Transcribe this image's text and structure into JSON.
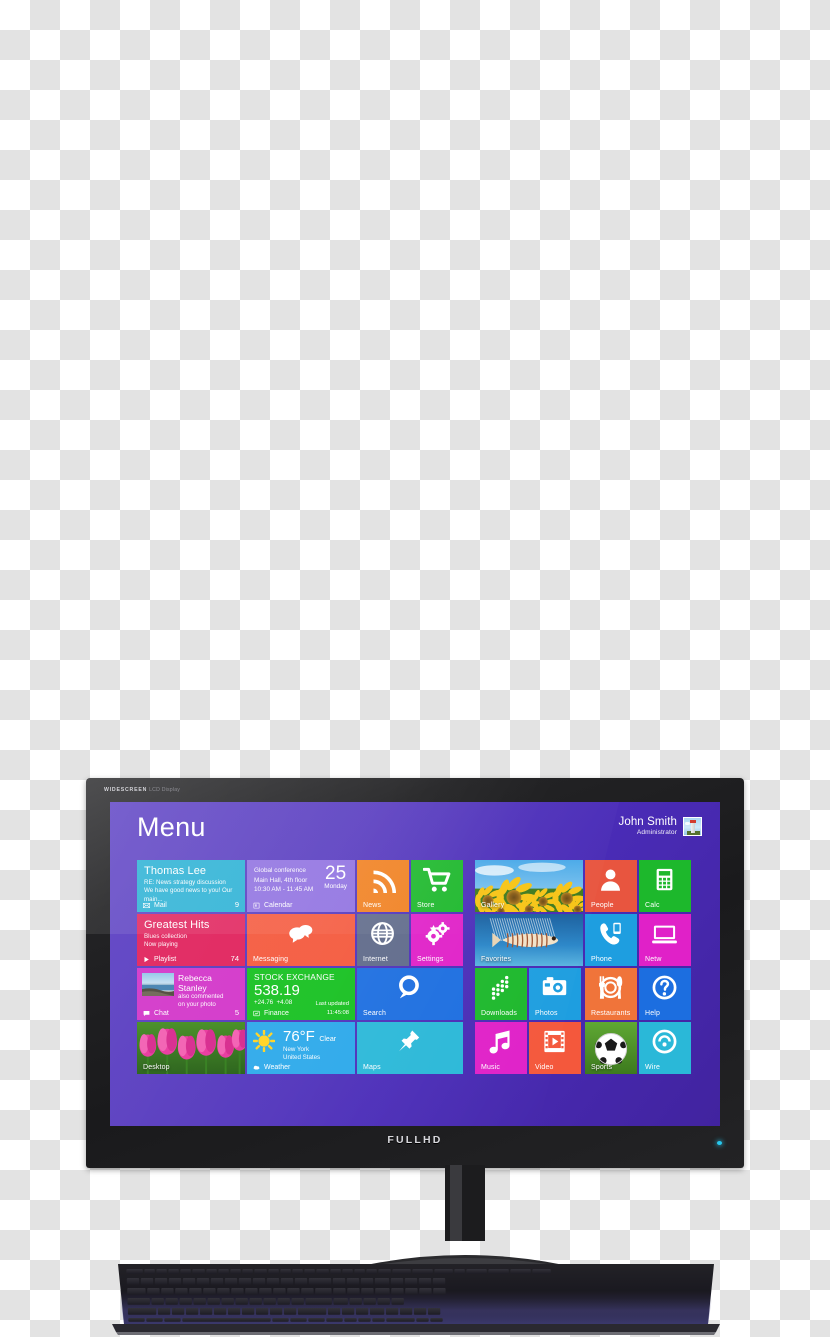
{
  "monitor": {
    "bezel_brand_bold": "WIDESCREEN",
    "bezel_brand_light": "LCD Display",
    "bottom_logo": "FULLHD",
    "power_led_color": "#27c8ee"
  },
  "screen": {
    "background_color": "#4a2cb8",
    "header": {
      "title": "Menu",
      "user_name": "John Smith",
      "user_role": "Administrator",
      "avatar_name": "lighthouse-avatar"
    },
    "tiles": [
      {
        "id": "mail",
        "kind": "info",
        "color": "#27b0d4",
        "heading": "Thomas Lee",
        "line1": "RE: News strategy discussion",
        "line2": "We have good news to you! Our main...",
        "label": "Mail",
        "badge": "9",
        "icon": "mail-icon"
      },
      {
        "id": "calendar",
        "kind": "calendar",
        "color": "#8e6fe0",
        "line1": "Global conference",
        "line2": "Main Hall, 4th floor",
        "line3": "10:30 AM - 11:45 AM",
        "day_number": "25",
        "day_name": "Monday",
        "label": "Calendar",
        "icon": "calendar-icon"
      },
      {
        "id": "news",
        "kind": "icon",
        "color": "#f08020",
        "label": "News",
        "icon": "rss-icon"
      },
      {
        "id": "store",
        "kind": "icon",
        "color": "#1db82c",
        "label": "Store",
        "icon": "cart-icon"
      },
      {
        "id": "gallery",
        "kind": "photo",
        "photo": "sunflowers",
        "label": "Gallery"
      },
      {
        "id": "people",
        "kind": "icon",
        "color": "#e8553f",
        "label": "People",
        "icon": "person-icon"
      },
      {
        "id": "calculator",
        "kind": "icon",
        "color": "#1db82c",
        "label": "Calc",
        "icon": "calculator-icon",
        "clipped": true
      },
      {
        "id": "playlist",
        "kind": "info",
        "color": "#e01f5a",
        "heading": "Greatest Hits",
        "line1": "Blues collection",
        "line2": "Now playing",
        "label": "Playlist",
        "badge": "74",
        "icon": "play-icon"
      },
      {
        "id": "messaging",
        "kind": "icon",
        "color": "#f4583c",
        "label": "Messaging",
        "icon": "chat-bubbles-icon"
      },
      {
        "id": "internet",
        "kind": "icon",
        "color": "#5f6a8a",
        "label": "Internet",
        "icon": "globe-icon"
      },
      {
        "id": "settings",
        "kind": "icon",
        "color": "#e021c8",
        "label": "Settings",
        "icon": "gears-icon"
      },
      {
        "id": "favorites",
        "kind": "photo",
        "photo": "lionfish",
        "label": "Favorites"
      },
      {
        "id": "phone",
        "kind": "icon",
        "color": "#1e9ee0",
        "label": "Phone",
        "icon": "phone-icon"
      },
      {
        "id": "network",
        "kind": "icon",
        "color": "#e021c8",
        "label": "Netw",
        "icon": "network-icon",
        "clipped": true
      },
      {
        "id": "chat",
        "kind": "info-photo",
        "color": "#d233c8",
        "photo": "seascape",
        "heading": "Rebecca Stanley",
        "line1": "also commented",
        "line2": "on your photo",
        "label": "Chat",
        "badge": "5",
        "icon": "chat-icon"
      },
      {
        "id": "finance",
        "kind": "finance",
        "color": "#15c01f",
        "heading": "STOCK EXCHANGE",
        "value": "538.19",
        "change_abs": "+24.76",
        "change_pct": "+4.08",
        "updated_label": "Last updated",
        "updated_time": "11:45:08",
        "label": "Finance",
        "icon": "finance-icon"
      },
      {
        "id": "search",
        "kind": "icon",
        "color": "#1c6ee0",
        "label": "Search",
        "icon": "magnifier-icon"
      },
      {
        "id": "downloads",
        "kind": "icon",
        "color": "#1db82c",
        "label": "Downloads",
        "icon": "downloads-icon"
      },
      {
        "id": "photos",
        "kind": "icon",
        "color": "#1e9ee0",
        "label": "Photos",
        "icon": "camera-icon"
      },
      {
        "id": "restaurants",
        "kind": "icon",
        "color": "#f0743a",
        "label": "Restaurants",
        "icon": "cutlery-icon"
      },
      {
        "id": "help",
        "kind": "icon",
        "color": "#1c6ee0",
        "label": "Help",
        "icon": "help-icon",
        "clipped": true
      },
      {
        "id": "desktop",
        "kind": "photo",
        "photo": "tulips",
        "label": "Desktop"
      },
      {
        "id": "weather",
        "kind": "weather",
        "color": "#2aa8ea",
        "temperature": "76°F",
        "condition": "Clear",
        "city": "New York",
        "country": "United States",
        "label": "Weather",
        "icon": "sun-icon"
      },
      {
        "id": "maps",
        "kind": "icon",
        "color": "#2ab8d8",
        "label": "Maps",
        "icon": "pin-icon"
      },
      {
        "id": "music",
        "kind": "icon",
        "color": "#e021c8",
        "label": "Music",
        "icon": "music-note-icon"
      },
      {
        "id": "video",
        "kind": "icon",
        "color": "#f4583c",
        "label": "Video",
        "icon": "film-icon"
      },
      {
        "id": "sports",
        "kind": "photo",
        "photo": "soccer",
        "label": "Sports"
      },
      {
        "id": "wireless",
        "kind": "icon",
        "color": "#2ab8d8",
        "label": "Wire",
        "icon": "wireless-icon",
        "clipped": true
      }
    ]
  }
}
